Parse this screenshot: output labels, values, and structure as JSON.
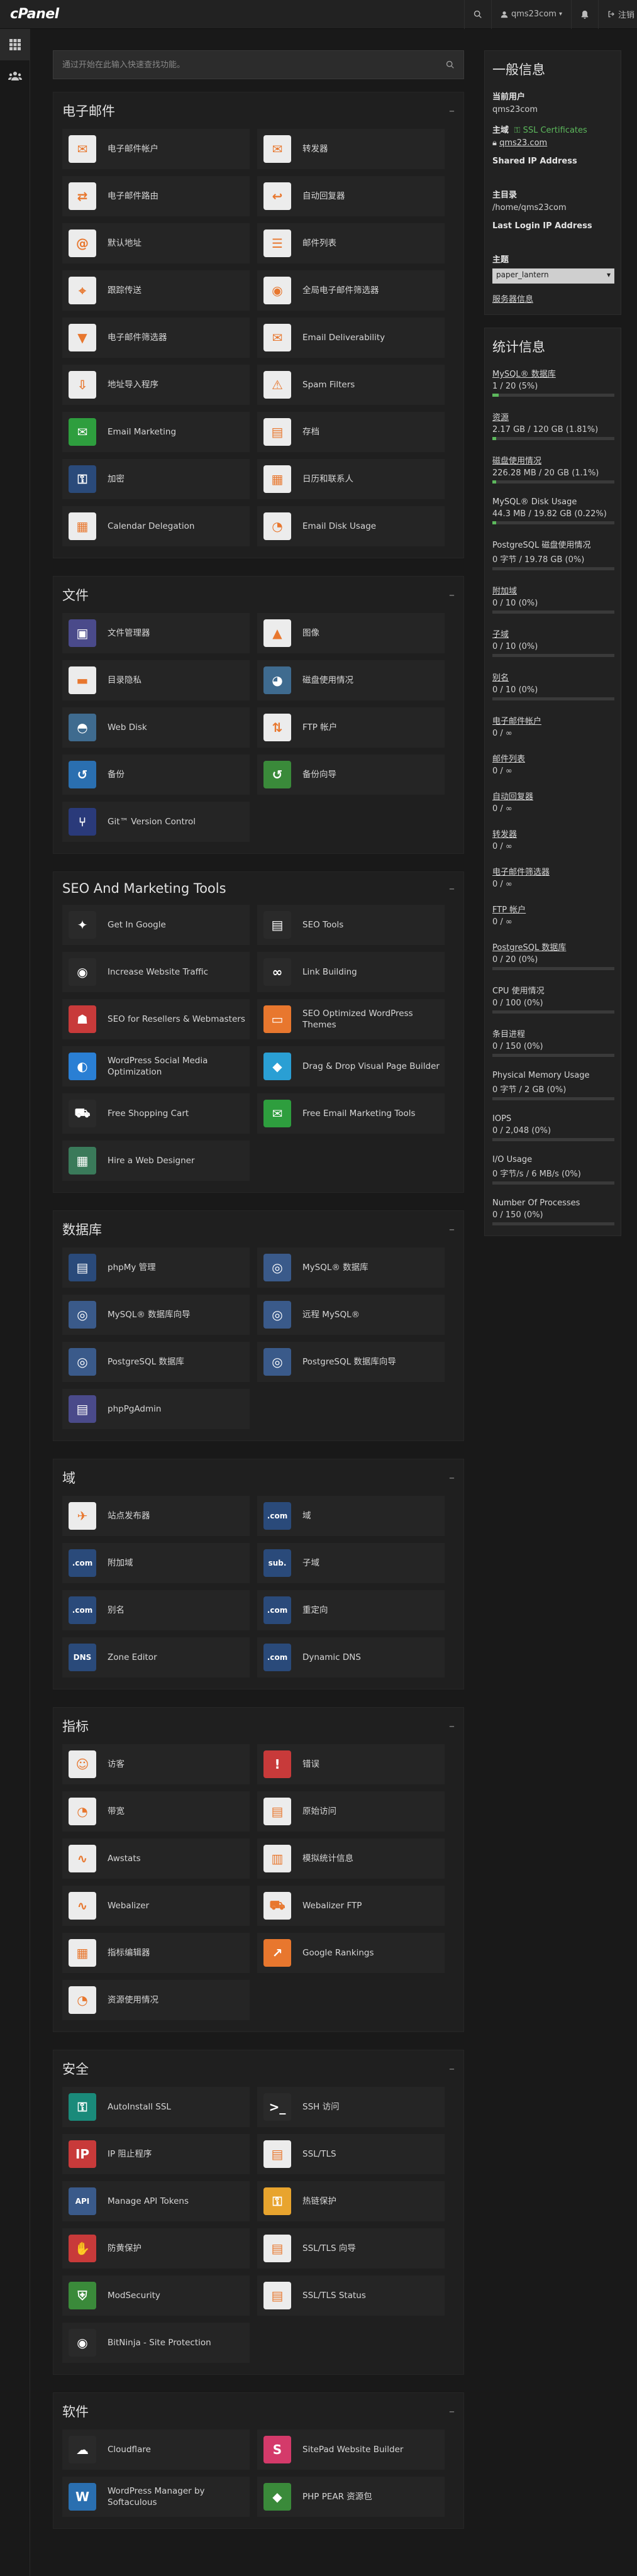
{
  "app": {
    "logo": "cPanel"
  },
  "topbar": {
    "user": "qms23com",
    "logout": "注销"
  },
  "search": {
    "placeholder": "通过开始在此输入快速查找功能。"
  },
  "sections": [
    {
      "title": "电子邮件",
      "items": [
        {
          "label": "电子邮件帐户",
          "icon": "email-accounts-icon",
          "color": "#ececec",
          "glyph": "✉"
        },
        {
          "label": "转发器",
          "icon": "forwarders-icon",
          "color": "#ececec",
          "glyph": "✉"
        },
        {
          "label": "电子邮件路由",
          "icon": "email-routing-icon",
          "color": "#ececec",
          "glyph": "⇄"
        },
        {
          "label": "自动回复器",
          "icon": "autoresponder-icon",
          "color": "#ececec",
          "glyph": "↩"
        },
        {
          "label": "默认地址",
          "icon": "default-address-icon",
          "color": "#ececec",
          "glyph": "@"
        },
        {
          "label": "邮件列表",
          "icon": "mailing-list-icon",
          "color": "#ececec",
          "glyph": "☰"
        },
        {
          "label": "跟踪传送",
          "icon": "track-delivery-icon",
          "color": "#ececec",
          "glyph": "⌖"
        },
        {
          "label": "全局电子邮件筛选器",
          "icon": "global-filter-icon",
          "color": "#ececec",
          "glyph": "◉"
        },
        {
          "label": "电子邮件筛选器",
          "icon": "email-filter-icon",
          "color": "#ececec",
          "glyph": "▼"
        },
        {
          "label": "Email Deliverability",
          "icon": "email-deliverability-icon",
          "color": "#ececec",
          "glyph": "✉"
        },
        {
          "label": "地址导入程序",
          "icon": "address-importer-icon",
          "color": "#ececec",
          "glyph": "⇩"
        },
        {
          "label": "Spam Filters",
          "icon": "spam-filters-icon",
          "color": "#ececec",
          "glyph": "⚠"
        },
        {
          "label": "Email Marketing",
          "icon": "email-marketing-icon",
          "color": "#2e9e3e",
          "glyph": "✉"
        },
        {
          "label": "存档",
          "icon": "archive-icon",
          "color": "#ececec",
          "glyph": "▤"
        },
        {
          "label": "加密",
          "icon": "encryption-icon",
          "color": "#2a4a7a",
          "glyph": "⚿"
        },
        {
          "label": "日历和联系人",
          "icon": "calendars-contacts-icon",
          "color": "#ececec",
          "glyph": "▦"
        },
        {
          "label": "Calendar Delegation",
          "icon": "calendar-delegation-icon",
          "color": "#ececec",
          "glyph": "▦"
        },
        {
          "label": "Email Disk Usage",
          "icon": "email-disk-usage-icon",
          "color": "#ececec",
          "glyph": "◔"
        }
      ]
    },
    {
      "title": "文件",
      "items": [
        {
          "label": "文件管理器",
          "icon": "file-manager-icon",
          "color": "#4a4a8a",
          "glyph": "▣"
        },
        {
          "label": "图像",
          "icon": "images-icon",
          "color": "#ececec",
          "glyph": "▲"
        },
        {
          "label": "目录隐私",
          "icon": "directory-privacy-icon",
          "color": "#ececec",
          "glyph": "▬"
        },
        {
          "label": "磁盘使用情况",
          "icon": "disk-usage-icon",
          "color": "#3f6b8f",
          "glyph": "◕"
        },
        {
          "label": "Web Disk",
          "icon": "web-disk-icon",
          "color": "#3f6b8f",
          "glyph": "◓"
        },
        {
          "label": "FTP 帐户",
          "icon": "ftp-accounts-icon",
          "color": "#ececec",
          "glyph": "⇅"
        },
        {
          "label": "备份",
          "icon": "backup-icon",
          "color": "#2a6fb0",
          "glyph": "↺"
        },
        {
          "label": "备份向导",
          "icon": "backup-wizard-icon",
          "color": "#3a8a3a",
          "glyph": "↺"
        },
        {
          "label": "Git™ Version Control",
          "icon": "git-icon",
          "color": "#2a3a7a",
          "glyph": "⑂"
        }
      ]
    },
    {
      "title": "SEO And Marketing Tools",
      "items": [
        {
          "label": "Get In Google",
          "icon": "get-in-google-icon",
          "color": "#2a2a2a",
          "glyph": "✦"
        },
        {
          "label": "SEO Tools",
          "icon": "seo-tools-icon",
          "color": "#2a2a2a",
          "glyph": "▤"
        },
        {
          "label": "Increase Website Traffic",
          "icon": "website-traffic-icon",
          "color": "#2a2a2a",
          "glyph": "◉"
        },
        {
          "label": "Link Building",
          "icon": "link-building-icon",
          "color": "#2a2a2a",
          "glyph": "∞"
        },
        {
          "label": "SEO for Resellers & Webmasters",
          "icon": "seo-resellers-icon",
          "color": "#c83a3a",
          "glyph": "☗"
        },
        {
          "label": "SEO Optimized WordPress Themes",
          "icon": "wordpress-themes-icon",
          "color": "#e8772e",
          "glyph": "▭"
        },
        {
          "label": "WordPress Social Media Optimization",
          "icon": "social-media-icon",
          "color": "#2a7fd4",
          "glyph": "◐"
        },
        {
          "label": "Drag & Drop Visual Page Builder",
          "icon": "page-builder-icon",
          "color": "#2a9fd4",
          "glyph": "◆"
        },
        {
          "label": "Free Shopping Cart",
          "icon": "shopping-cart-icon",
          "color": "#2a2a2a",
          "glyph": "⛟"
        },
        {
          "label": "Free Email Marketing Tools",
          "icon": "email-marketing-tools-icon",
          "color": "#2e9e3e",
          "glyph": "✉"
        },
        {
          "label": "Hire a Web Designer",
          "icon": "web-designer-icon",
          "color": "#3a7a5a",
          "glyph": "▦"
        }
      ]
    },
    {
      "title": "数据库",
      "items": [
        {
          "label": "phpMy 管理",
          "icon": "phpmyadmin-icon",
          "color": "#2a4a7a",
          "glyph": "▤"
        },
        {
          "label": "MySQL® 数据库",
          "icon": "mysql-databases-icon",
          "color": "#3a5a8a",
          "glyph": "◎"
        },
        {
          "label": "MySQL® 数据库向导",
          "icon": "mysql-wizard-icon",
          "color": "#3a5a8a",
          "glyph": "◎"
        },
        {
          "label": "远程 MySQL®",
          "icon": "remote-mysql-icon",
          "color": "#3a5a8a",
          "glyph": "◎"
        },
        {
          "label": "PostgreSQL 数据库",
          "icon": "postgresql-databases-icon",
          "color": "#3a5a8a",
          "glyph": "◎"
        },
        {
          "label": "PostgreSQL 数据库向导",
          "icon": "postgresql-wizard-icon",
          "color": "#3a5a8a",
          "glyph": "◎"
        },
        {
          "label": "phpPgAdmin",
          "icon": "phppgadmin-icon",
          "color": "#4a4a8a",
          "glyph": "▤"
        }
      ]
    },
    {
      "title": "域",
      "items": [
        {
          "label": "站点发布器",
          "icon": "site-publisher-icon",
          "color": "#ececec",
          "glyph": "✈"
        },
        {
          "label": "域",
          "icon": "domains-icon",
          "color": "#2a4a7a",
          "glyph": ".com"
        },
        {
          "label": "附加域",
          "icon": "addon-domains-icon",
          "color": "#2a4a7a",
          "glyph": ".com"
        },
        {
          "label": "子域",
          "icon": "subdomains-icon",
          "color": "#2a4a7a",
          "glyph": "sub."
        },
        {
          "label": "别名",
          "icon": "aliases-icon",
          "color": "#2a4a7a",
          "glyph": ".com"
        },
        {
          "label": "重定向",
          "icon": "redirects-icon",
          "color": "#2a4a7a",
          "glyph": ".com"
        },
        {
          "label": "Zone Editor",
          "icon": "zone-editor-icon",
          "color": "#2a4a7a",
          "glyph": "DNS"
        },
        {
          "label": "Dynamic DNS",
          "icon": "dynamic-dns-icon",
          "color": "#2a4a7a",
          "glyph": ".com"
        }
      ]
    },
    {
      "title": "指标",
      "items": [
        {
          "label": "访客",
          "icon": "visitors-icon",
          "color": "#ececec",
          "glyph": "☺"
        },
        {
          "label": "错误",
          "icon": "errors-icon",
          "color": "#c83a3a",
          "glyph": "!"
        },
        {
          "label": "带宽",
          "icon": "bandwidth-icon",
          "color": "#ececec",
          "glyph": "◔"
        },
        {
          "label": "原始访问",
          "icon": "raw-access-icon",
          "color": "#ececec",
          "glyph": "▤"
        },
        {
          "label": "Awstats",
          "icon": "awstats-icon",
          "color": "#ececec",
          "glyph": "∿"
        },
        {
          "label": "模拟统计信息",
          "icon": "analog-stats-icon",
          "color": "#ececec",
          "glyph": "▥"
        },
        {
          "label": "Webalizer",
          "icon": "webalizer-icon",
          "color": "#ececec",
          "glyph": "∿"
        },
        {
          "label": "Webalizer FTP",
          "icon": "webalizer-ftp-icon",
          "color": "#ececec",
          "glyph": "⛟"
        },
        {
          "label": "指标编辑器",
          "icon": "metrics-editor-icon",
          "color": "#ececec",
          "glyph": "▦"
        },
        {
          "label": "Google Rankings",
          "icon": "google-rankings-icon",
          "color": "#e8772e",
          "glyph": "↗"
        },
        {
          "label": "资源使用情况",
          "icon": "resource-usage-icon",
          "color": "#ececec",
          "glyph": "◔"
        }
      ]
    },
    {
      "title": "安全",
      "items": [
        {
          "label": "AutoInstall SSL",
          "icon": "autoinstall-ssl-icon",
          "color": "#1a8a7a",
          "glyph": "⚿"
        },
        {
          "label": "SSH 访问",
          "icon": "ssh-access-icon",
          "color": "#2a2a2a",
          "glyph": ">_"
        },
        {
          "label": "IP 阻止程序",
          "icon": "ip-blocker-icon",
          "color": "#c83a3a",
          "glyph": "IP"
        },
        {
          "label": "SSL/TLS",
          "icon": "ssl-tls-icon",
          "color": "#ececec",
          "glyph": "▤"
        },
        {
          "label": "Manage API Tokens",
          "icon": "api-tokens-icon",
          "color": "#3a5a8a",
          "glyph": "API"
        },
        {
          "label": "热链保护",
          "icon": "hotlink-protection-icon",
          "color": "#e8a42e",
          "glyph": "⚿"
        },
        {
          "label": "防黄保护",
          "icon": "leech-protection-icon",
          "color": "#c83a3a",
          "glyph": "✋"
        },
        {
          "label": "SSL/TLS 向导",
          "icon": "ssl-tls-wizard-icon",
          "color": "#ececec",
          "glyph": "▤"
        },
        {
          "label": "ModSecurity",
          "icon": "modsecurity-icon",
          "color": "#3a8a3a",
          "glyph": "⛨"
        },
        {
          "label": "SSL/TLS Status",
          "icon": "ssl-tls-status-icon",
          "color": "#ececec",
          "glyph": "▤"
        },
        {
          "label": "BitNinja - Site Protection",
          "icon": "bitninja-icon",
          "color": "#2a2a2a",
          "glyph": "◉"
        }
      ]
    },
    {
      "title": "软件",
      "items": [
        {
          "label": "Cloudflare",
          "icon": "cloudflare-icon",
          "color": "#2a2a2a",
          "glyph": "☁"
        },
        {
          "label": "SitePad Website Builder",
          "icon": "sitepad-icon",
          "color": "#d43a6a",
          "glyph": "S"
        },
        {
          "label": "WordPress Manager by Softaculous",
          "icon": "wordpress-manager-icon",
          "color": "#2a6fb0",
          "glyph": "W"
        },
        {
          "label": "PHP PEAR 资源包",
          "icon": "php-pear-icon",
          "color": "#3a8a3a",
          "glyph": "◆"
        }
      ]
    }
  ],
  "general": {
    "title": "一般信息",
    "current_user_label": "当前用户",
    "current_user": "qms23com",
    "main_domain_label": "主域",
    "ssl_status": "SSL Certificates",
    "main_domain": "qms23.com",
    "shared_ip_label": "Shared IP Address",
    "home_dir_label": "主目录",
    "home_dir": "/home/qms23com",
    "last_login_label": "Last Login IP Address",
    "theme_label": "主题",
    "theme_value": "paper_lantern",
    "server_info": "服务器信息"
  },
  "stats": {
    "title": "统计信息",
    "items": [
      {
        "label": "MySQL® 数据库",
        "value": "1 / 20   (5%)",
        "pct": 5,
        "link": true
      },
      {
        "label": "资源",
        "value": "2.17 GB / 120 GB (1.81%)",
        "pct": 1.81,
        "link": true
      },
      {
        "label": "磁盘使用情况",
        "value": "226.28 MB / 20 GB (1.1%)",
        "pct": 1.1,
        "link": true
      },
      {
        "label": "MySQL® Disk Usage",
        "value": "44.3 MB / 19.82 GB (0.22%)",
        "pct": 0.22,
        "link": false
      },
      {
        "label": "PostgreSQL 磁盘使用情况",
        "value": "0 字节 / 19.78 GB   (0%)",
        "pct": 0,
        "link": false
      },
      {
        "label": "附加域",
        "value": "0 / 10   (0%)",
        "pct": 0,
        "link": true
      },
      {
        "label": "子域",
        "value": "0 / 10   (0%)",
        "pct": 0,
        "link": true
      },
      {
        "label": "别名",
        "value": "0 / 10   (0%)",
        "pct": 0,
        "link": true
      },
      {
        "label": "电子邮件帐户",
        "value": "0 / ∞",
        "pct": null,
        "link": true
      },
      {
        "label": "邮件列表",
        "value": "0 / ∞",
        "pct": null,
        "link": true
      },
      {
        "label": "自动回复器",
        "value": "0 / ∞",
        "pct": null,
        "link": true
      },
      {
        "label": "转发器",
        "value": "0 / ∞",
        "pct": null,
        "link": true
      },
      {
        "label": "电子邮件筛选器",
        "value": "0 / ∞",
        "pct": null,
        "link": true
      },
      {
        "label": "FTP 帐户",
        "value": "0 / ∞",
        "pct": null,
        "link": true
      },
      {
        "label": "PostgreSQL 数据库",
        "value": "0 / 20   (0%)",
        "pct": 0,
        "link": true
      },
      {
        "label": "CPU 使用情况",
        "value": "0 / 100   (0%)",
        "pct": 0,
        "link": false
      },
      {
        "label": "条目进程",
        "value": "0 / 150   (0%)",
        "pct": 0,
        "link": false
      },
      {
        "label": "Physical Memory Usage",
        "value": "0 字节 / 2 GB   (0%)",
        "pct": 0,
        "link": false
      },
      {
        "label": "IOPS",
        "value": "0 / 2,048   (0%)",
        "pct": 0,
        "link": false
      },
      {
        "label": "I/O Usage",
        "value": "0 字节/s / 6 MB/s   (0%)",
        "pct": 0,
        "link": false
      },
      {
        "label": "Number Of Processes",
        "value": "0 / 150   (0%)",
        "pct": 0,
        "link": false
      }
    ]
  }
}
